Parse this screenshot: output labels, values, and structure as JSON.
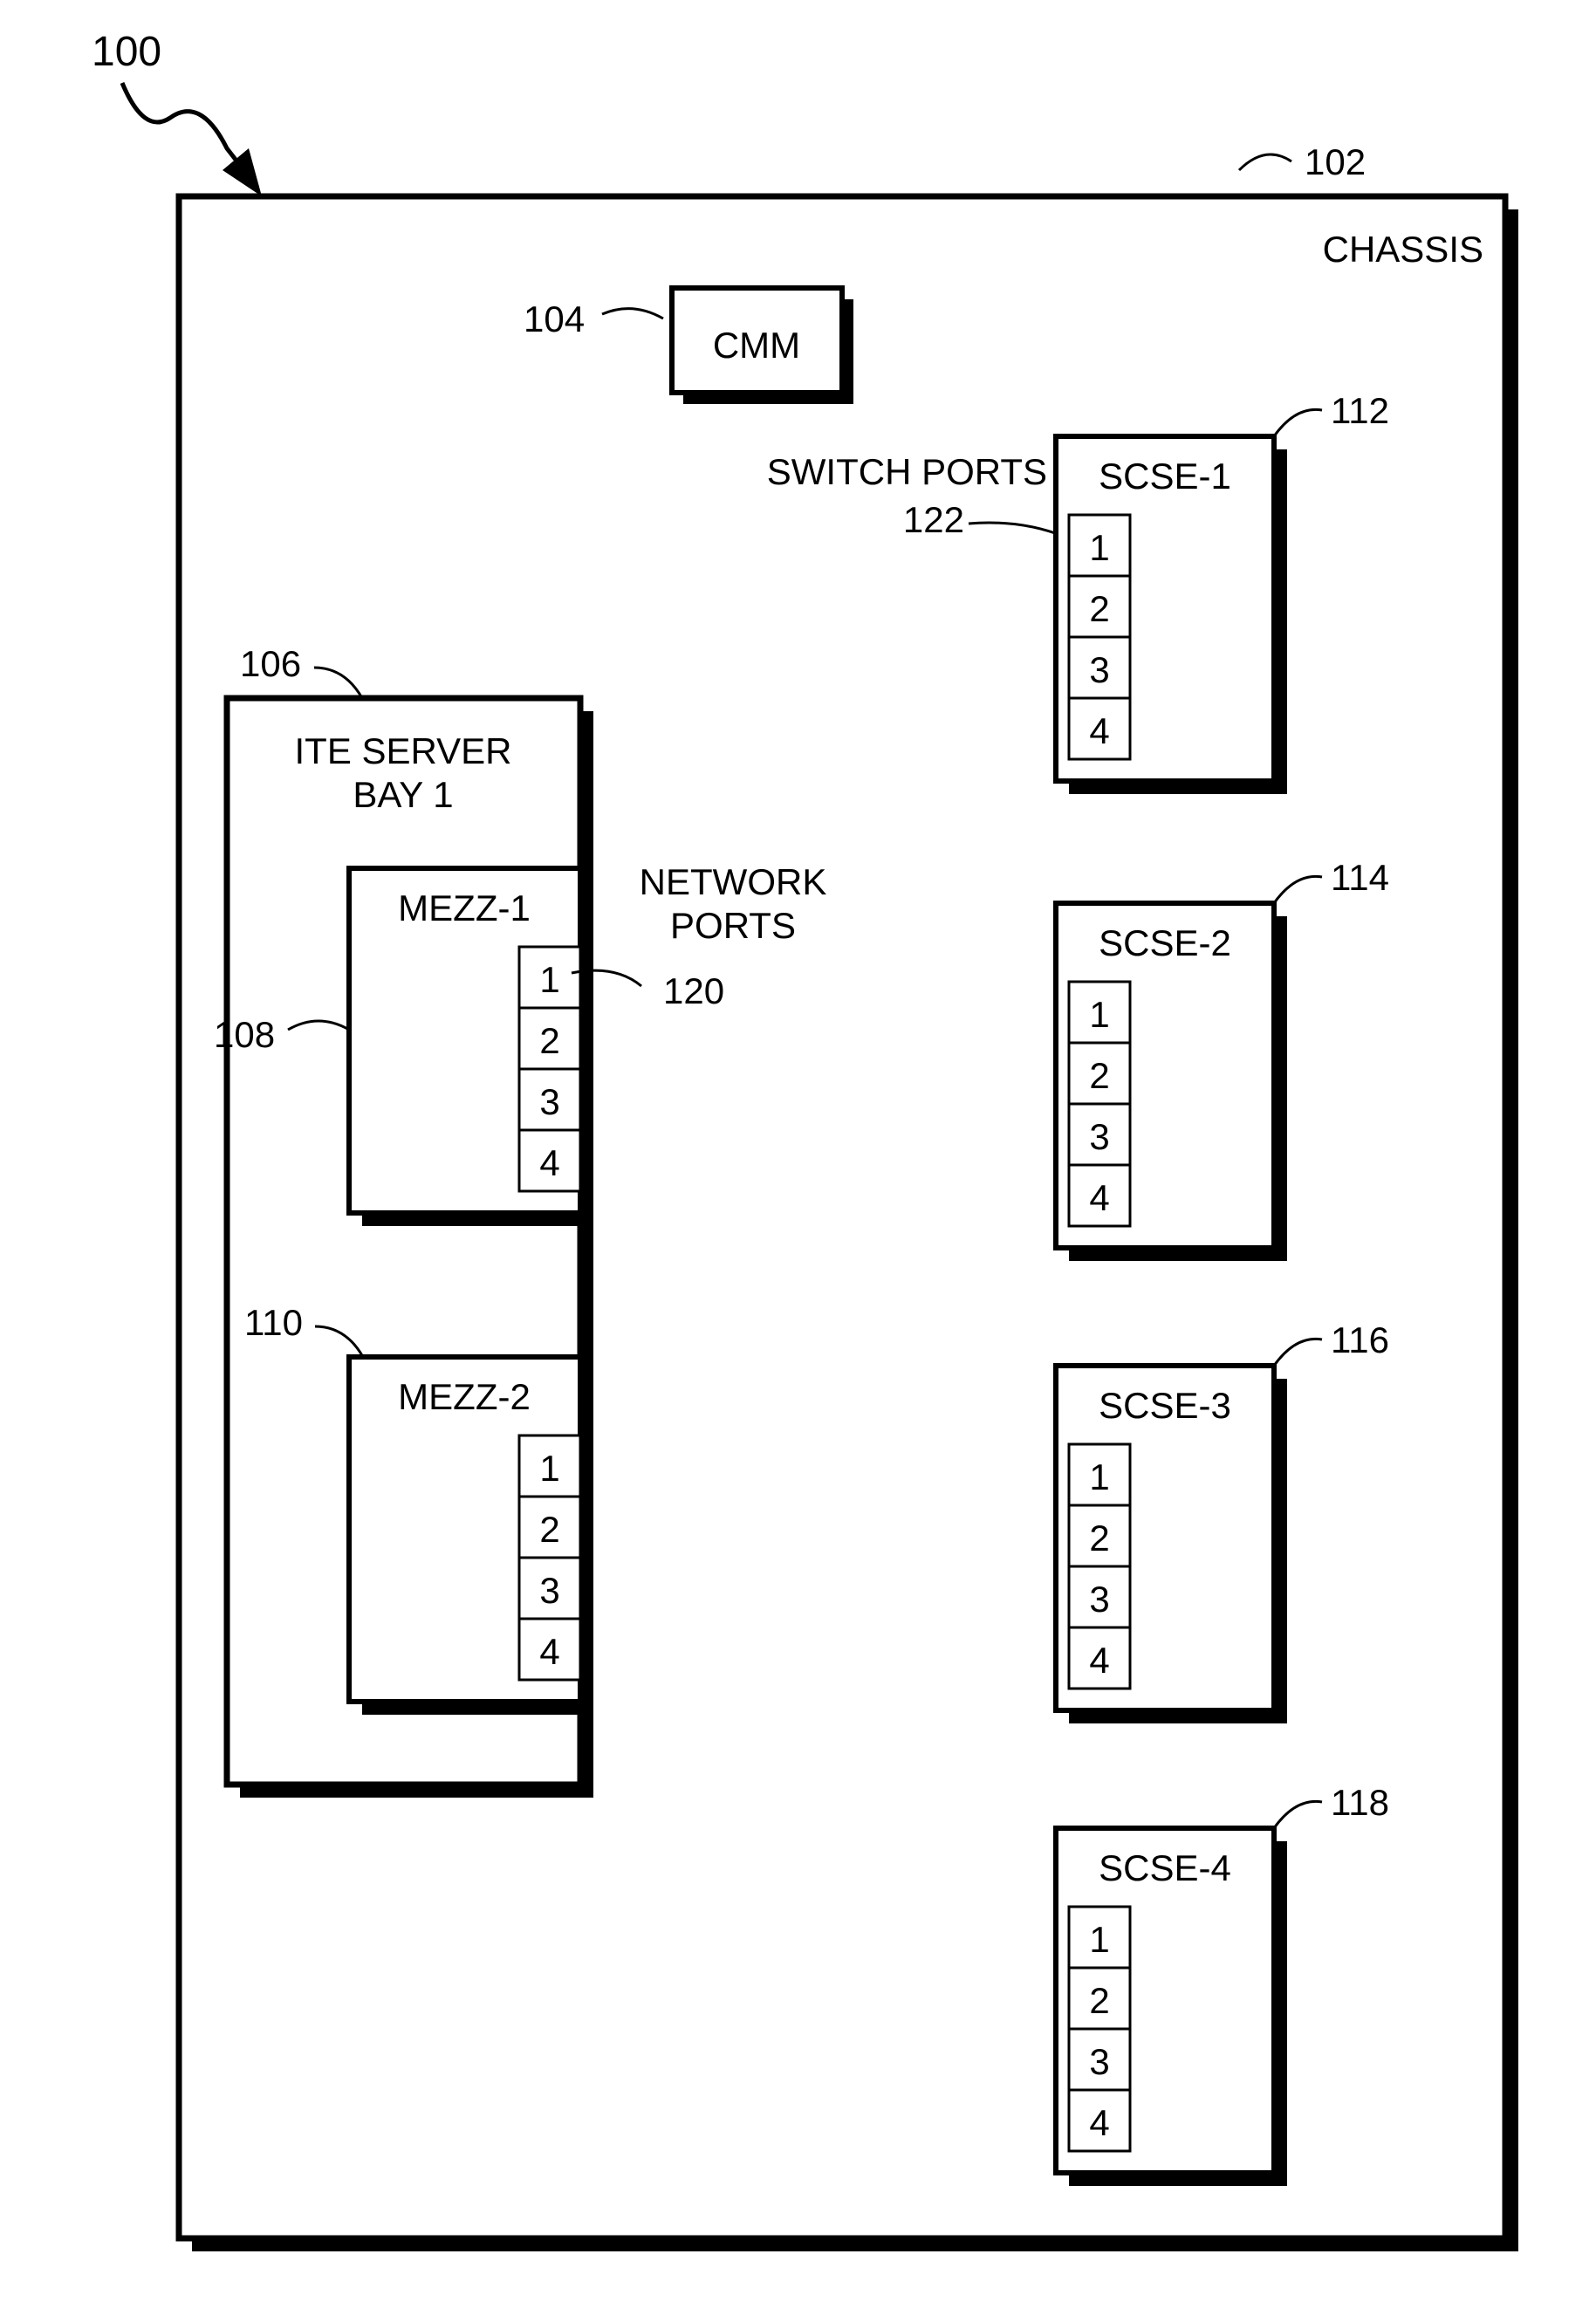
{
  "refs": {
    "r100": "100",
    "r102": "102",
    "r104": "104",
    "r106": "106",
    "r108": "108",
    "r110": "110",
    "r112": "112",
    "r114": "114",
    "r116": "116",
    "r118": "118",
    "r120": "120",
    "r122": "122"
  },
  "labels": {
    "chassis": "CHASSIS",
    "cmm": "CMM",
    "ite_line1": "ITE SERVER",
    "ite_line2": "BAY 1",
    "mezz1": "MEZZ-1",
    "mezz2": "MEZZ-2",
    "net_ports_l1": "NETWORK",
    "net_ports_l2": "PORTS",
    "switch_ports": "SWITCH PORTS",
    "scse1": "SCSE-1",
    "scse2": "SCSE-2",
    "scse3": "SCSE-3",
    "scse4": "SCSE-4"
  },
  "ports": {
    "p1": "1",
    "p2": "2",
    "p3": "3",
    "p4": "4"
  }
}
